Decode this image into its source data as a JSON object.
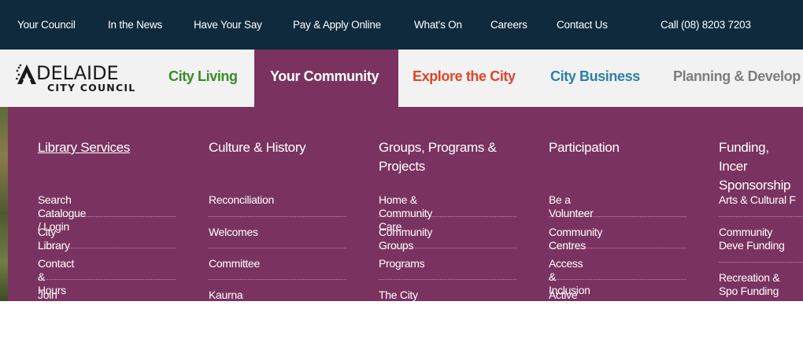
{
  "utility_nav": {
    "items": [
      "Your Council",
      "In the News",
      "Have Your Say",
      "Pay & Apply Online",
      "What's On",
      "Careers",
      "Contact Us"
    ],
    "phone": "Call (08) 8203 7203"
  },
  "logo": {
    "word": "DELAIDE",
    "subtitle": "CITY COUNCIL"
  },
  "main_nav": {
    "items": [
      {
        "label": "City Living",
        "color": "#3a8a2a"
      },
      {
        "label": "Your Community",
        "color": "#ffffff",
        "active": true
      },
      {
        "label": "Explore the City",
        "color": "#e0452b"
      },
      {
        "label": "City Business",
        "color": "#2e7fa6"
      },
      {
        "label": "Planning & Develop",
        "color": "#7d7d7d"
      }
    ]
  },
  "mega_menu": {
    "background": "#7a3360",
    "columns": [
      {
        "heading": "Library Services",
        "links": [
          "Search Catalogue / Login",
          "City Library",
          "Contact & Hours",
          "Join Us"
        ]
      },
      {
        "heading": "Culture & History",
        "links": [
          "Reconciliation",
          "Welcomes",
          "Committee",
          "Kaurna"
        ]
      },
      {
        "heading": "Groups, Programs & Projects",
        "links": [
          "Home & Community Care",
          "Community Groups",
          "Programs",
          "The City of Adelaide Prize"
        ]
      },
      {
        "heading": "Participation",
        "links": [
          "Be a Volunteer",
          "Community Centres",
          "Access & Inclusion",
          "Active in the City"
        ]
      },
      {
        "heading": "Funding, Incer Sponsorship",
        "links": [
          "Arts & Cultural F",
          "Community Deve Funding",
          "Recreation & Spo Funding"
        ]
      }
    ]
  }
}
